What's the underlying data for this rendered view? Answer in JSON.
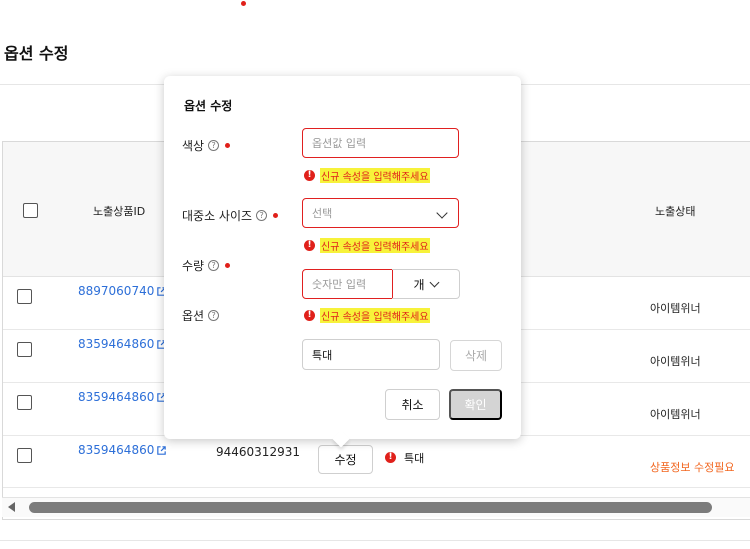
{
  "page": {
    "title": "옵션 수정"
  },
  "table": {
    "headers": {
      "product_id": "노출상품ID",
      "status": "노출상태"
    },
    "rows": [
      {
        "product_id": "8897060740",
        "status": "아이템위너"
      },
      {
        "product_id": "8359464860",
        "status": "아이템위너"
      },
      {
        "product_id": "8359464860",
        "status": "아이템위너"
      },
      {
        "product_id": "8359464860",
        "option_number": "94460312931",
        "edit_label": "수정",
        "option_value": "특대",
        "status": "상품정보 수정필요"
      }
    ]
  },
  "popover": {
    "title": "옵션 수정",
    "fields": {
      "color": {
        "label": "색상",
        "placeholder": "옵션값 입력",
        "error": "신규 속성을 입력해주세요"
      },
      "size": {
        "label": "대중소 사이즈",
        "placeholder": "선택",
        "error": "신규 속성을 입력해주세요"
      },
      "quantity": {
        "label": "수량",
        "placeholder": "숫자만 입력",
        "unit": "개",
        "error": "신규 속성을 입력해주세요"
      },
      "option": {
        "label": "옵션",
        "value": "특대",
        "delete_label": "삭제"
      }
    },
    "cancel_label": "취소",
    "confirm_label": "확인"
  },
  "icons": {
    "help": "?",
    "error": "!"
  },
  "colors": {
    "error": "#e0201a",
    "link": "#2d6fd8",
    "warning": "#f2661f",
    "highlight": "#f7f23a"
  }
}
